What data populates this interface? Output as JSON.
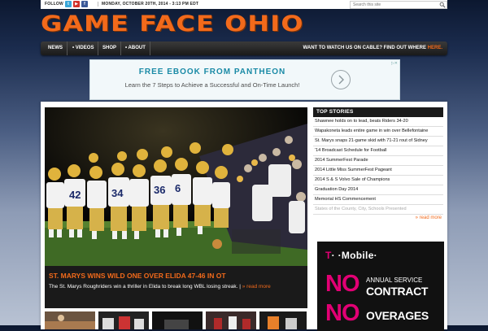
{
  "topbar": {
    "follow_label": "FOLLOW",
    "social": [
      {
        "name": "twitter-icon",
        "glyph": "t"
      },
      {
        "name": "youtube-icon",
        "glyph": "▶"
      },
      {
        "name": "facebook-icon",
        "glyph": "f"
      }
    ],
    "date": "MONDAY, OCTOBER 20TH, 2014 - 3:13 PM EDT",
    "search_placeholder": "Search this site"
  },
  "logo": {
    "text": "GAME FACE OHIO"
  },
  "nav": {
    "items": [
      "NEWS",
      "• VIDEOS",
      "SHOP",
      "• ABOUT"
    ],
    "cta_text": "WANT TO WATCH US ON CABLE? FIND OUT WHERE",
    "cta_link": "HERE."
  },
  "ad": {
    "title": "FREE EBOOK FROM PANTHEON",
    "subtitle": "Learn the 7 Steps to Achieve a Successful and On-Time Launch!"
  },
  "hero": {
    "headline": "ST. MARYS WINS WILD ONE OVER ELIDA 47-46 IN OT",
    "summary": "The St. Marys Roughriders win a thriller in Elida to break long WBL losing streak.",
    "separator": "|",
    "read_more": "» read more"
  },
  "top_stories": {
    "title": "TOP STORIES",
    "items": [
      "Shawnee holds on to lead, beats Riders 34-20",
      "Wapakoneta leads entire game in win over Bellefontaine",
      "St. Marys snaps 21-game skid with 71-21 rout of Sidney",
      "'14 Broadcast Schedule for Football",
      "2014 SummerFest Parade",
      "2014 Little Miss SummerFest Pageant",
      "2014 S & S Volvo Sale of Champions",
      "Graduation Day 2014",
      "Memorial HS Commencement",
      "States of the County, City, Schools Presented"
    ],
    "read_more": "» read more"
  },
  "tmobile_ad": {
    "brand_t": "T",
    "brand_rest": "· ·Mobile·",
    "no1": "NO",
    "line1a": "ANNUAL SERVICE",
    "line1b": "CONTRACT",
    "no2": "NO",
    "line2": "OVERAGES"
  },
  "colors": {
    "accent": "#f26a1b",
    "magenta": "#e20074",
    "nav": "#1a1a1a"
  }
}
